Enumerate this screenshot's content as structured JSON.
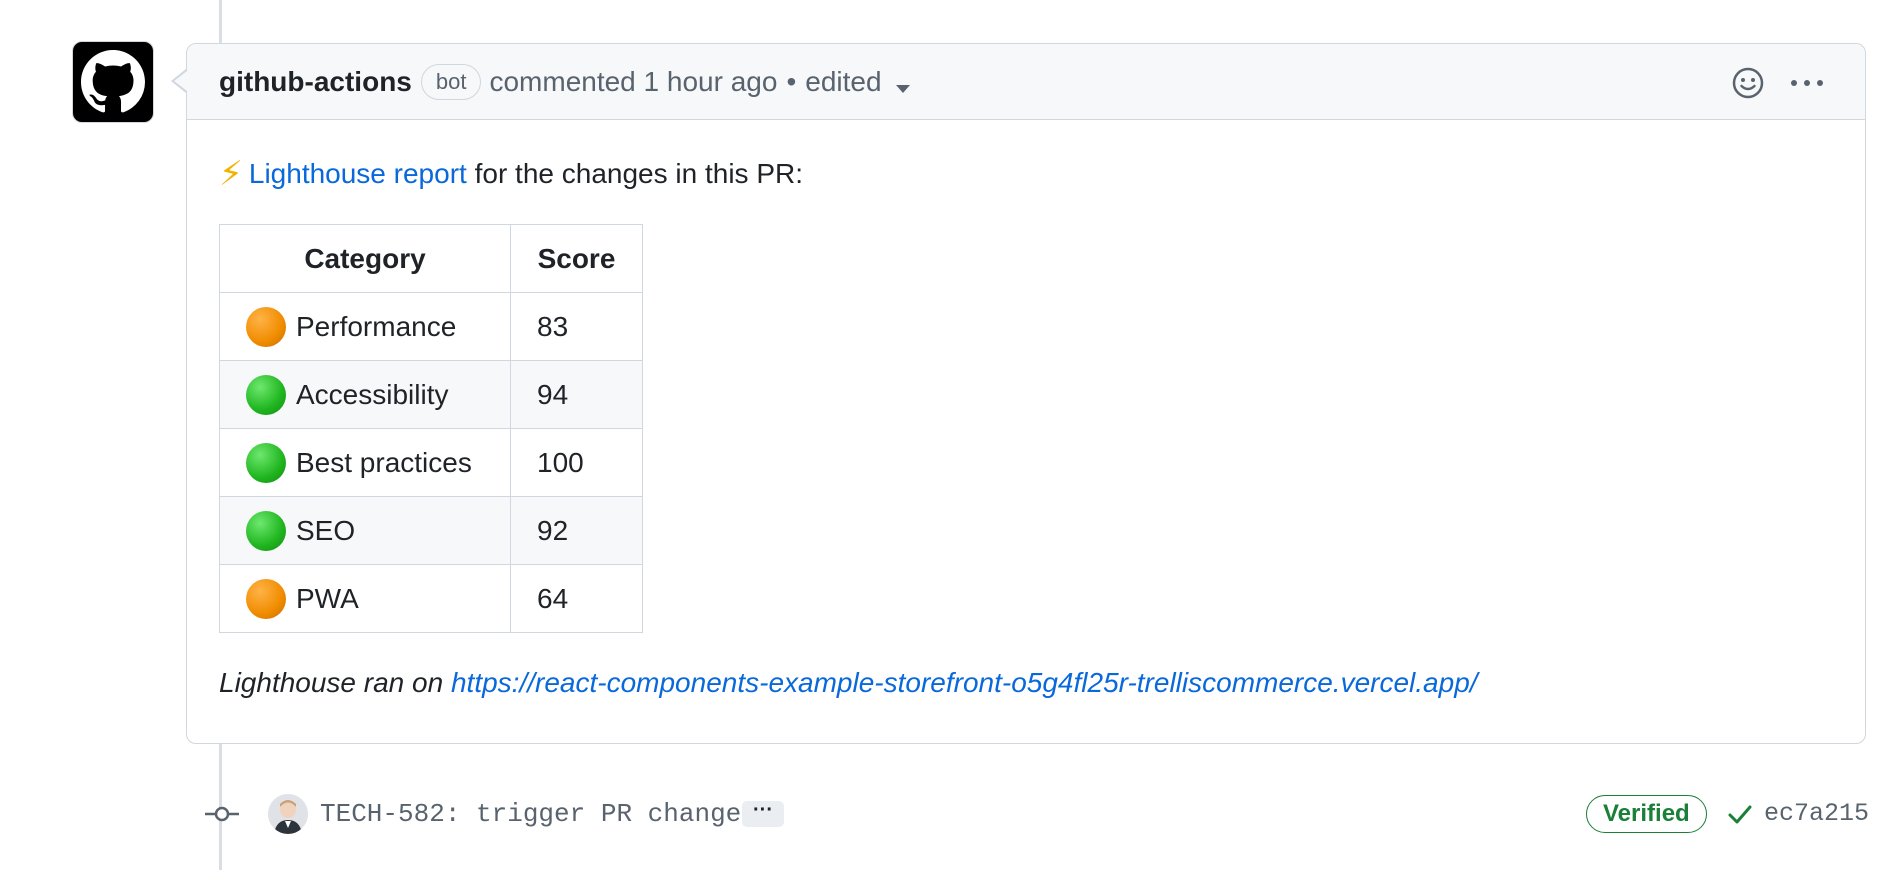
{
  "comment": {
    "author": "github-actions",
    "bot_badge": "bot",
    "commented_text": "commented 1 hour ago",
    "separator": "•",
    "edited_text": "edited",
    "intro_emoji": "⚡",
    "intro_link": "Lighthouse report",
    "intro_rest": " for the changes in this PR:",
    "footer_prefix": "Lighthouse ran on ",
    "footer_link": "https://react-components-example-storefront-o5g4fl25r-trelliscommerce.vercel.app/"
  },
  "table": {
    "headers": [
      "Category",
      "Score"
    ],
    "rows": [
      {
        "status_color": "#f08c00",
        "category": "Performance",
        "score": "83"
      },
      {
        "status_color": "#1fb51f",
        "category": "Accessibility",
        "score": "94"
      },
      {
        "status_color": "#1fb51f",
        "category": "Best practices",
        "score": "100"
      },
      {
        "status_color": "#1fb51f",
        "category": "SEO",
        "score": "92"
      },
      {
        "status_color": "#f08c00",
        "category": "PWA",
        "score": "64"
      }
    ]
  },
  "commit": {
    "message": "TECH-582: trigger PR change",
    "expand_label": "···",
    "verified_label": "Verified",
    "sha": "ec7a215"
  },
  "colors": {
    "link": "#0969da",
    "verified": "#1a7f37",
    "orange_status": "#f08c00",
    "green_status": "#1fb51f"
  },
  "icons": {
    "avatar": "github-octocat-icon",
    "reaction": "smiley-icon",
    "menu": "kebab-icon",
    "commit_node": "git-commit-icon",
    "check": "check-icon"
  }
}
